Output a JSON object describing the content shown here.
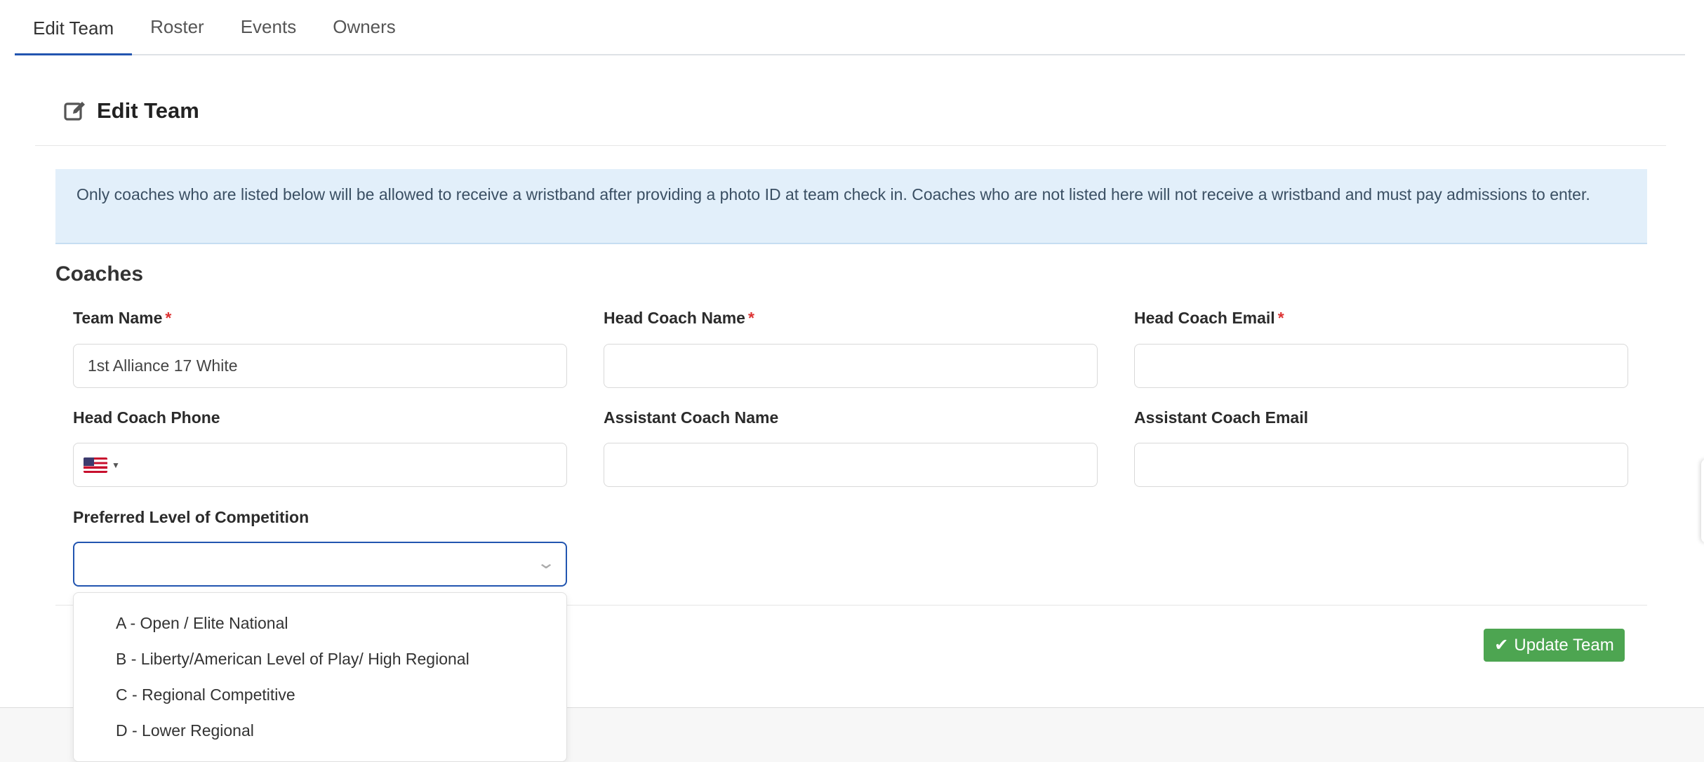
{
  "tabs": [
    {
      "label": "Edit Team"
    },
    {
      "label": "Roster"
    },
    {
      "label": "Events"
    },
    {
      "label": "Owners"
    }
  ],
  "panel": {
    "title": "Edit Team",
    "icon": "edit-icon"
  },
  "alert": {
    "text": "Only coaches who are listed below will be allowed to receive a wristband after providing a photo ID at team check in. Coaches who are not listed here will not receive a wristband and must pay admissions to enter."
  },
  "section": {
    "title": "Coaches"
  },
  "fields": {
    "team_name": {
      "label": "Team Name",
      "required": "*",
      "value": "1st Alliance 17 White"
    },
    "head_coach_name": {
      "label": "Head Coach Name",
      "required": "*",
      "value": ""
    },
    "head_coach_email": {
      "label": "Head Coach Email",
      "required": "*",
      "value": ""
    },
    "head_coach_phone": {
      "label": "Head Coach Phone",
      "value": "",
      "country_flag": "us-flag-icon"
    },
    "assistant_coach_name": {
      "label": "Assistant Coach Name",
      "value": ""
    },
    "assistant_coach_email": {
      "label": "Assistant Coach Email",
      "value": ""
    },
    "competition_level": {
      "label": "Preferred Level of Competition",
      "value": ""
    }
  },
  "dropdown": {
    "options": [
      {
        "label": "A - Open / Elite National"
      },
      {
        "label": "B - Liberty/American Level of Play/ High Regional"
      },
      {
        "label": "C - Regional Competitive"
      },
      {
        "label": "D - Lower Regional"
      }
    ]
  },
  "buttons": {
    "update": "Update Team",
    "update_icon": "check-icon"
  },
  "colors": {
    "accent": "#2255b0",
    "success": "#4da551",
    "alert_bg": "#e2effa",
    "required": "#dd3333"
  }
}
